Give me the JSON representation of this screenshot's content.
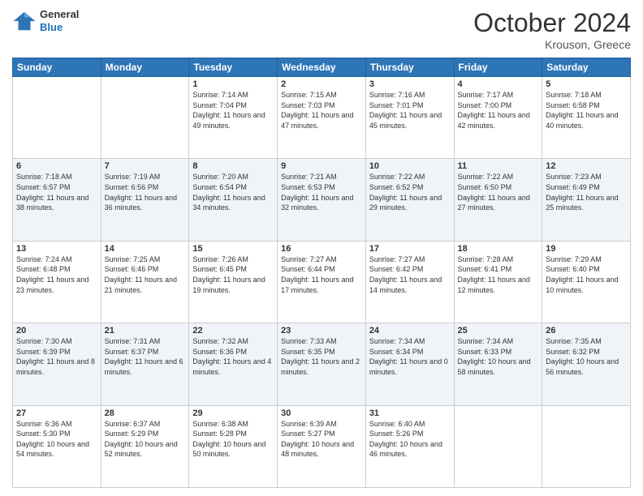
{
  "header": {
    "logo": {
      "general": "General",
      "blue": "Blue"
    },
    "title": "October 2024",
    "location": "Krouson, Greece"
  },
  "days_of_week": [
    "Sunday",
    "Monday",
    "Tuesday",
    "Wednesday",
    "Thursday",
    "Friday",
    "Saturday"
  ],
  "weeks": [
    [
      {
        "day": "",
        "sunrise": "",
        "sunset": "",
        "daylight": ""
      },
      {
        "day": "",
        "sunrise": "",
        "sunset": "",
        "daylight": ""
      },
      {
        "day": "1",
        "sunrise": "Sunrise: 7:14 AM",
        "sunset": "Sunset: 7:04 PM",
        "daylight": "Daylight: 11 hours and 49 minutes."
      },
      {
        "day": "2",
        "sunrise": "Sunrise: 7:15 AM",
        "sunset": "Sunset: 7:03 PM",
        "daylight": "Daylight: 11 hours and 47 minutes."
      },
      {
        "day": "3",
        "sunrise": "Sunrise: 7:16 AM",
        "sunset": "Sunset: 7:01 PM",
        "daylight": "Daylight: 11 hours and 45 minutes."
      },
      {
        "day": "4",
        "sunrise": "Sunrise: 7:17 AM",
        "sunset": "Sunset: 7:00 PM",
        "daylight": "Daylight: 11 hours and 42 minutes."
      },
      {
        "day": "5",
        "sunrise": "Sunrise: 7:18 AM",
        "sunset": "Sunset: 6:58 PM",
        "daylight": "Daylight: 11 hours and 40 minutes."
      }
    ],
    [
      {
        "day": "6",
        "sunrise": "Sunrise: 7:18 AM",
        "sunset": "Sunset: 6:57 PM",
        "daylight": "Daylight: 11 hours and 38 minutes."
      },
      {
        "day": "7",
        "sunrise": "Sunrise: 7:19 AM",
        "sunset": "Sunset: 6:56 PM",
        "daylight": "Daylight: 11 hours and 36 minutes."
      },
      {
        "day": "8",
        "sunrise": "Sunrise: 7:20 AM",
        "sunset": "Sunset: 6:54 PM",
        "daylight": "Daylight: 11 hours and 34 minutes."
      },
      {
        "day": "9",
        "sunrise": "Sunrise: 7:21 AM",
        "sunset": "Sunset: 6:53 PM",
        "daylight": "Daylight: 11 hours and 32 minutes."
      },
      {
        "day": "10",
        "sunrise": "Sunrise: 7:22 AM",
        "sunset": "Sunset: 6:52 PM",
        "daylight": "Daylight: 11 hours and 29 minutes."
      },
      {
        "day": "11",
        "sunrise": "Sunrise: 7:22 AM",
        "sunset": "Sunset: 6:50 PM",
        "daylight": "Daylight: 11 hours and 27 minutes."
      },
      {
        "day": "12",
        "sunrise": "Sunrise: 7:23 AM",
        "sunset": "Sunset: 6:49 PM",
        "daylight": "Daylight: 11 hours and 25 minutes."
      }
    ],
    [
      {
        "day": "13",
        "sunrise": "Sunrise: 7:24 AM",
        "sunset": "Sunset: 6:48 PM",
        "daylight": "Daylight: 11 hours and 23 minutes."
      },
      {
        "day": "14",
        "sunrise": "Sunrise: 7:25 AM",
        "sunset": "Sunset: 6:46 PM",
        "daylight": "Daylight: 11 hours and 21 minutes."
      },
      {
        "day": "15",
        "sunrise": "Sunrise: 7:26 AM",
        "sunset": "Sunset: 6:45 PM",
        "daylight": "Daylight: 11 hours and 19 minutes."
      },
      {
        "day": "16",
        "sunrise": "Sunrise: 7:27 AM",
        "sunset": "Sunset: 6:44 PM",
        "daylight": "Daylight: 11 hours and 17 minutes."
      },
      {
        "day": "17",
        "sunrise": "Sunrise: 7:27 AM",
        "sunset": "Sunset: 6:42 PM",
        "daylight": "Daylight: 11 hours and 14 minutes."
      },
      {
        "day": "18",
        "sunrise": "Sunrise: 7:28 AM",
        "sunset": "Sunset: 6:41 PM",
        "daylight": "Daylight: 11 hours and 12 minutes."
      },
      {
        "day": "19",
        "sunrise": "Sunrise: 7:29 AM",
        "sunset": "Sunset: 6:40 PM",
        "daylight": "Daylight: 11 hours and 10 minutes."
      }
    ],
    [
      {
        "day": "20",
        "sunrise": "Sunrise: 7:30 AM",
        "sunset": "Sunset: 6:39 PM",
        "daylight": "Daylight: 11 hours and 8 minutes."
      },
      {
        "day": "21",
        "sunrise": "Sunrise: 7:31 AM",
        "sunset": "Sunset: 6:37 PM",
        "daylight": "Daylight: 11 hours and 6 minutes."
      },
      {
        "day": "22",
        "sunrise": "Sunrise: 7:32 AM",
        "sunset": "Sunset: 6:36 PM",
        "daylight": "Daylight: 11 hours and 4 minutes."
      },
      {
        "day": "23",
        "sunrise": "Sunrise: 7:33 AM",
        "sunset": "Sunset: 6:35 PM",
        "daylight": "Daylight: 11 hours and 2 minutes."
      },
      {
        "day": "24",
        "sunrise": "Sunrise: 7:34 AM",
        "sunset": "Sunset: 6:34 PM",
        "daylight": "Daylight: 11 hours and 0 minutes."
      },
      {
        "day": "25",
        "sunrise": "Sunrise: 7:34 AM",
        "sunset": "Sunset: 6:33 PM",
        "daylight": "Daylight: 10 hours and 58 minutes."
      },
      {
        "day": "26",
        "sunrise": "Sunrise: 7:35 AM",
        "sunset": "Sunset: 6:32 PM",
        "daylight": "Daylight: 10 hours and 56 minutes."
      }
    ],
    [
      {
        "day": "27",
        "sunrise": "Sunrise: 6:36 AM",
        "sunset": "Sunset: 5:30 PM",
        "daylight": "Daylight: 10 hours and 54 minutes."
      },
      {
        "day": "28",
        "sunrise": "Sunrise: 6:37 AM",
        "sunset": "Sunset: 5:29 PM",
        "daylight": "Daylight: 10 hours and 52 minutes."
      },
      {
        "day": "29",
        "sunrise": "Sunrise: 6:38 AM",
        "sunset": "Sunset: 5:28 PM",
        "daylight": "Daylight: 10 hours and 50 minutes."
      },
      {
        "day": "30",
        "sunrise": "Sunrise: 6:39 AM",
        "sunset": "Sunset: 5:27 PM",
        "daylight": "Daylight: 10 hours and 48 minutes."
      },
      {
        "day": "31",
        "sunrise": "Sunrise: 6:40 AM",
        "sunset": "Sunset: 5:26 PM",
        "daylight": "Daylight: 10 hours and 46 minutes."
      },
      {
        "day": "",
        "sunrise": "",
        "sunset": "",
        "daylight": ""
      },
      {
        "day": "",
        "sunrise": "",
        "sunset": "",
        "daylight": ""
      }
    ]
  ]
}
